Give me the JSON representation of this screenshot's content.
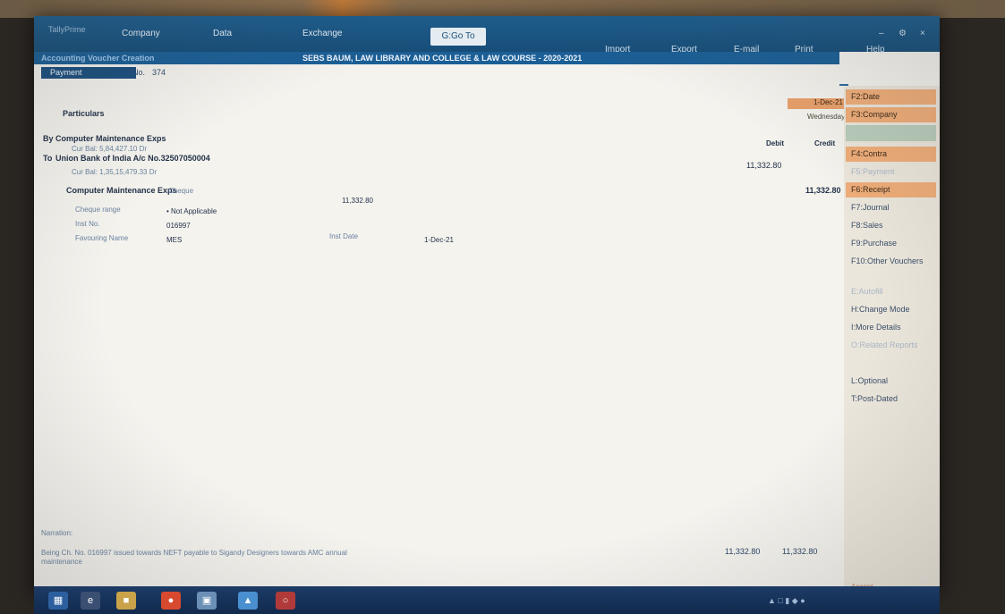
{
  "menu": {
    "company": "Company",
    "data": "Data",
    "exchange": "Exchange",
    "goto": "G:Go To",
    "import": "Import",
    "export": "Export",
    "email": "E-mail",
    "print": "Print",
    "help": "Help"
  },
  "title_strip": {
    "left": "Accounting Voucher Creation",
    "center": "SEBS BAUM, LAW LIBRARY AND COLLEGE & LAW COURSE - 2020-2021"
  },
  "voucher": {
    "type": "Payment",
    "no_label": "No.",
    "number": "374",
    "date": "1-Dec-21",
    "day": "Wednesday",
    "particulars_header": "Particulars",
    "debit_header": "Debit",
    "credit_header": "Credit",
    "by_label": "By",
    "by_ledger": "Computer Maintenance Exps",
    "by_bal": "Cur Bal: 5,84,427.10 Dr",
    "to_label": "To",
    "to_ledger": "Union Bank of India A/c No.32507050004",
    "to_bal": "Cur Bal: 1,35,15,479.33 Dr",
    "debit_amount": "11,332.80",
    "credit_amount": "11,332.80",
    "bank_alloc_ledger": "Computer Maintenance Exps",
    "bank_alloc_mode": "Cheque",
    "bank_alloc_amount": "11,332.80",
    "rows": [
      {
        "label": "Cheque range",
        "value": "• Not Applicable"
      },
      {
        "label": "Inst No.",
        "value": "016997"
      },
      {
        "label": "Favouring Name",
        "value": "MES"
      }
    ],
    "inst_date_label": "Inst Date",
    "inst_date_value": "1-Dec-21"
  },
  "narration": {
    "label": "Narration:",
    "text": "Being Ch. No. 016997 issued towards NEFT payable to Sigandy Designers towards AMC annual",
    "text2": "maintenance"
  },
  "totals": {
    "debit": "11,332.80",
    "credit": "11,332.80"
  },
  "sidebar": [
    {
      "label": "F2:Date",
      "state": "hl"
    },
    {
      "label": "F3:Company",
      "state": "hl"
    },
    {
      "label": "F4:Contra",
      "state": "hl"
    },
    {
      "label": "F5:Payment",
      "state": "faded"
    },
    {
      "label": "F6:Receipt",
      "state": "hl"
    },
    {
      "label": "F7:Journal",
      "state": "normal"
    },
    {
      "label": "F8:Sales",
      "state": "normal"
    },
    {
      "label": "F9:Purchase",
      "state": "normal"
    },
    {
      "label": "F10:Other Vouchers",
      "state": "normal"
    },
    {
      "label": "E:Autofill",
      "state": "faded"
    },
    {
      "label": "H:Change Mode",
      "state": "normal"
    },
    {
      "label": "I:More Details",
      "state": "normal"
    },
    {
      "label": "O:Related Reports",
      "state": "faded"
    },
    {
      "label": "L:Optional",
      "state": "normal"
    },
    {
      "label": "T:Post-Dated",
      "state": "normal"
    }
  ],
  "bottom_label": "Accept"
}
